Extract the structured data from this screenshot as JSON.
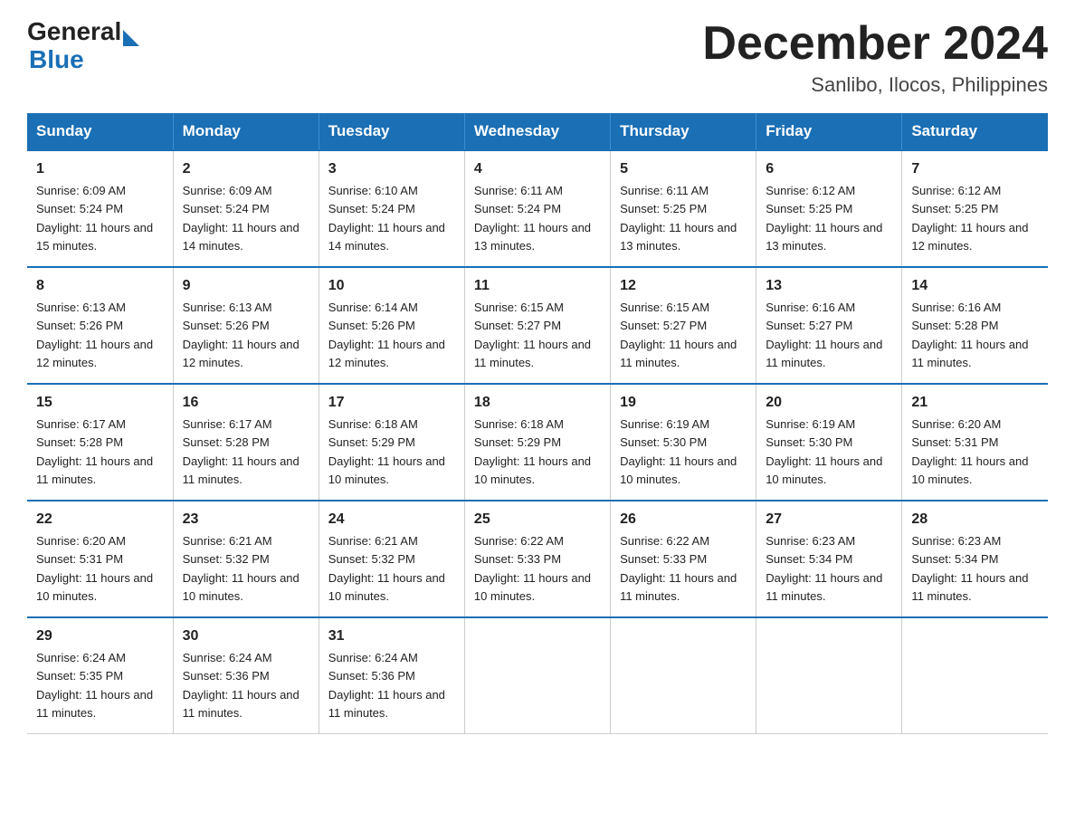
{
  "header": {
    "logo_general": "General",
    "logo_blue": "Blue",
    "month_title": "December 2024",
    "location": "Sanlibo, Ilocos, Philippines"
  },
  "days_header": [
    "Sunday",
    "Monday",
    "Tuesday",
    "Wednesday",
    "Thursday",
    "Friday",
    "Saturday"
  ],
  "weeks": [
    [
      {
        "num": "1",
        "rise": "6:09 AM",
        "set": "5:24 PM",
        "daylight": "11 hours and 15 minutes."
      },
      {
        "num": "2",
        "rise": "6:09 AM",
        "set": "5:24 PM",
        "daylight": "11 hours and 14 minutes."
      },
      {
        "num": "3",
        "rise": "6:10 AM",
        "set": "5:24 PM",
        "daylight": "11 hours and 14 minutes."
      },
      {
        "num": "4",
        "rise": "6:11 AM",
        "set": "5:24 PM",
        "daylight": "11 hours and 13 minutes."
      },
      {
        "num": "5",
        "rise": "6:11 AM",
        "set": "5:25 PM",
        "daylight": "11 hours and 13 minutes."
      },
      {
        "num": "6",
        "rise": "6:12 AM",
        "set": "5:25 PM",
        "daylight": "11 hours and 13 minutes."
      },
      {
        "num": "7",
        "rise": "6:12 AM",
        "set": "5:25 PM",
        "daylight": "11 hours and 12 minutes."
      }
    ],
    [
      {
        "num": "8",
        "rise": "6:13 AM",
        "set": "5:26 PM",
        "daylight": "11 hours and 12 minutes."
      },
      {
        "num": "9",
        "rise": "6:13 AM",
        "set": "5:26 PM",
        "daylight": "11 hours and 12 minutes."
      },
      {
        "num": "10",
        "rise": "6:14 AM",
        "set": "5:26 PM",
        "daylight": "11 hours and 12 minutes."
      },
      {
        "num": "11",
        "rise": "6:15 AM",
        "set": "5:27 PM",
        "daylight": "11 hours and 11 minutes."
      },
      {
        "num": "12",
        "rise": "6:15 AM",
        "set": "5:27 PM",
        "daylight": "11 hours and 11 minutes."
      },
      {
        "num": "13",
        "rise": "6:16 AM",
        "set": "5:27 PM",
        "daylight": "11 hours and 11 minutes."
      },
      {
        "num": "14",
        "rise": "6:16 AM",
        "set": "5:28 PM",
        "daylight": "11 hours and 11 minutes."
      }
    ],
    [
      {
        "num": "15",
        "rise": "6:17 AM",
        "set": "5:28 PM",
        "daylight": "11 hours and 11 minutes."
      },
      {
        "num": "16",
        "rise": "6:17 AM",
        "set": "5:28 PM",
        "daylight": "11 hours and 11 minutes."
      },
      {
        "num": "17",
        "rise": "6:18 AM",
        "set": "5:29 PM",
        "daylight": "11 hours and 10 minutes."
      },
      {
        "num": "18",
        "rise": "6:18 AM",
        "set": "5:29 PM",
        "daylight": "11 hours and 10 minutes."
      },
      {
        "num": "19",
        "rise": "6:19 AM",
        "set": "5:30 PM",
        "daylight": "11 hours and 10 minutes."
      },
      {
        "num": "20",
        "rise": "6:19 AM",
        "set": "5:30 PM",
        "daylight": "11 hours and 10 minutes."
      },
      {
        "num": "21",
        "rise": "6:20 AM",
        "set": "5:31 PM",
        "daylight": "11 hours and 10 minutes."
      }
    ],
    [
      {
        "num": "22",
        "rise": "6:20 AM",
        "set": "5:31 PM",
        "daylight": "11 hours and 10 minutes."
      },
      {
        "num": "23",
        "rise": "6:21 AM",
        "set": "5:32 PM",
        "daylight": "11 hours and 10 minutes."
      },
      {
        "num": "24",
        "rise": "6:21 AM",
        "set": "5:32 PM",
        "daylight": "11 hours and 10 minutes."
      },
      {
        "num": "25",
        "rise": "6:22 AM",
        "set": "5:33 PM",
        "daylight": "11 hours and 10 minutes."
      },
      {
        "num": "26",
        "rise": "6:22 AM",
        "set": "5:33 PM",
        "daylight": "11 hours and 11 minutes."
      },
      {
        "num": "27",
        "rise": "6:23 AM",
        "set": "5:34 PM",
        "daylight": "11 hours and 11 minutes."
      },
      {
        "num": "28",
        "rise": "6:23 AM",
        "set": "5:34 PM",
        "daylight": "11 hours and 11 minutes."
      }
    ],
    [
      {
        "num": "29",
        "rise": "6:24 AM",
        "set": "5:35 PM",
        "daylight": "11 hours and 11 minutes."
      },
      {
        "num": "30",
        "rise": "6:24 AM",
        "set": "5:36 PM",
        "daylight": "11 hours and 11 minutes."
      },
      {
        "num": "31",
        "rise": "6:24 AM",
        "set": "5:36 PM",
        "daylight": "11 hours and 11 minutes."
      },
      null,
      null,
      null,
      null
    ]
  ],
  "labels": {
    "sunrise": "Sunrise:",
    "sunset": "Sunset:",
    "daylight": "Daylight:"
  }
}
